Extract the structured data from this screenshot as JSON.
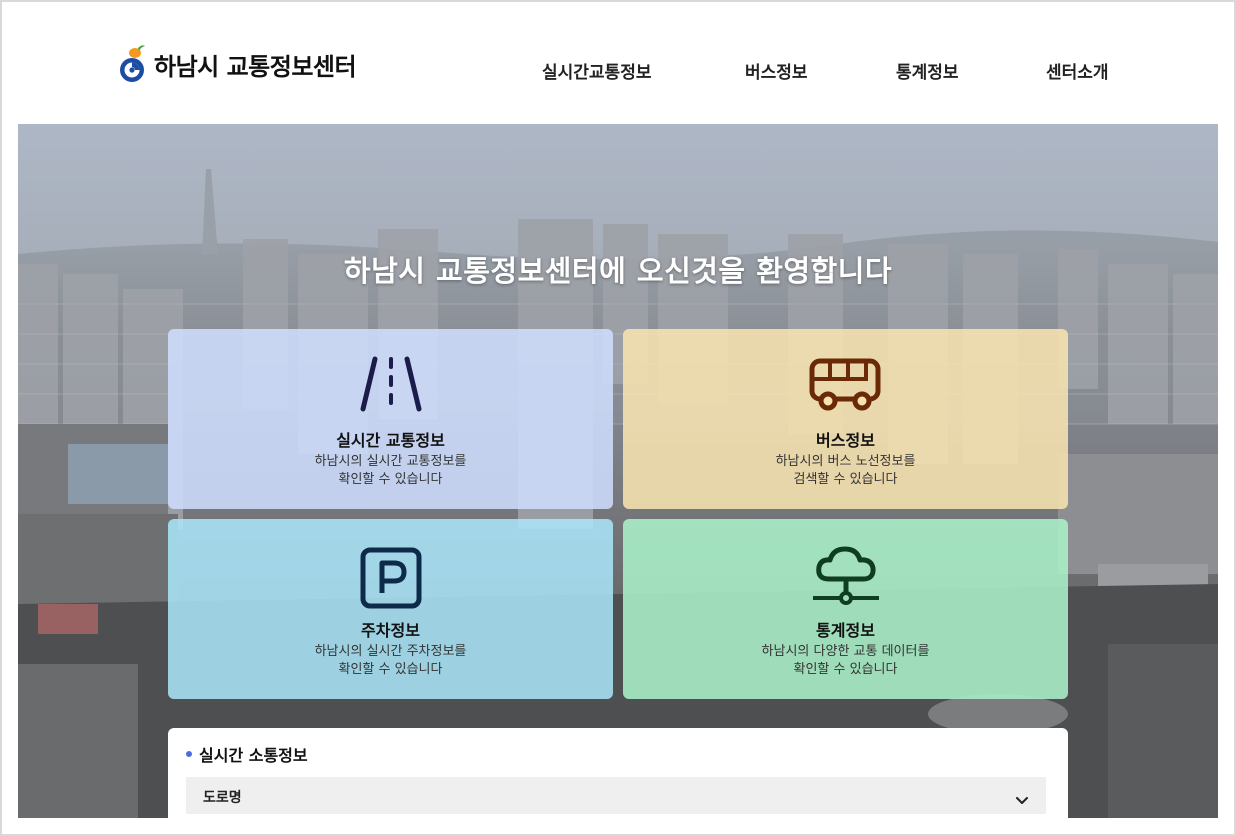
{
  "header": {
    "logo_text": "하남시 교통정보센터",
    "nav": [
      {
        "label": "실시간교통정보"
      },
      {
        "label": "버스정보"
      },
      {
        "label": "통계정보"
      },
      {
        "label": "센터소개"
      }
    ]
  },
  "hero": {
    "title": "하남시 교통정보센터에 오신것을 환영합니다"
  },
  "cards": {
    "traffic": {
      "title": "실시간 교통정보",
      "desc_line1": "하남시의 실시간 교통정보를",
      "desc_line2": "확인할 수 있습니다",
      "icon": "road-icon"
    },
    "bus": {
      "title": "버스정보",
      "desc_line1": "하남시의 버스 노선정보를",
      "desc_line2": "검색할 수 있습니다",
      "icon": "bus-icon"
    },
    "parking": {
      "title": "주차정보",
      "desc_line1": "하남시의 실시간 주차정보를",
      "desc_line2": "확인할 수 있습니다",
      "icon": "parking-icon"
    },
    "stats": {
      "title": "통계정보",
      "desc_line1": "하남시의 다양한 교통 데이터를",
      "desc_line2": "확인할 수 있습니다",
      "icon": "network-cloud-icon"
    }
  },
  "panel": {
    "title": "실시간 소통정보",
    "select_value": "도로명"
  },
  "colors": {
    "accent_dot": "#4a6fd8",
    "traffic_icon": "#1c1c4a",
    "bus_icon": "#6b2a07",
    "parking_icon": "#0d2a4a",
    "stats_icon": "#0f3d1f"
  }
}
